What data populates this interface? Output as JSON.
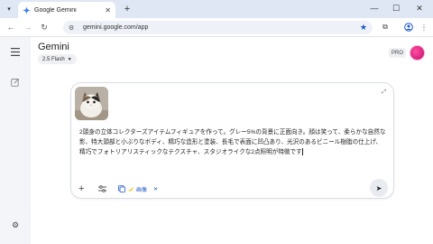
{
  "browser": {
    "tab_title": "Google Gemini",
    "new_tab_symbol": "+",
    "close_tab_symbol": "✕",
    "url": "gemini.google.com/app",
    "window": {
      "minimize": "—",
      "maximize": "☐",
      "close": "✕"
    }
  },
  "app": {
    "brand": "Gemini",
    "model": "2.5 Flash",
    "pro_badge": "PRO"
  },
  "composer": {
    "prompt_text": "2頭身の立体コレクターズアイテムフィギュアを作って。グレー5%の背景に正面向き。顔は笑って、柔らかな自然な影、特大頭部と小ぶりなボディ、精巧な造形と塗装、長毛で表面に凹凸あり、光沢のあるビニール樹脂の仕上げ、精巧でフォトリアリスティックなテクスチャ、スタジオライクな2点照明が特徴です",
    "chip_label": "画像",
    "chip_close": "✕",
    "plus_symbol": "+",
    "send_symbol": "➤"
  },
  "icons": {
    "sidebar": [
      "menu-icon",
      "new-chat-icon",
      "settings-icon"
    ],
    "accent": "#1a56c8"
  }
}
